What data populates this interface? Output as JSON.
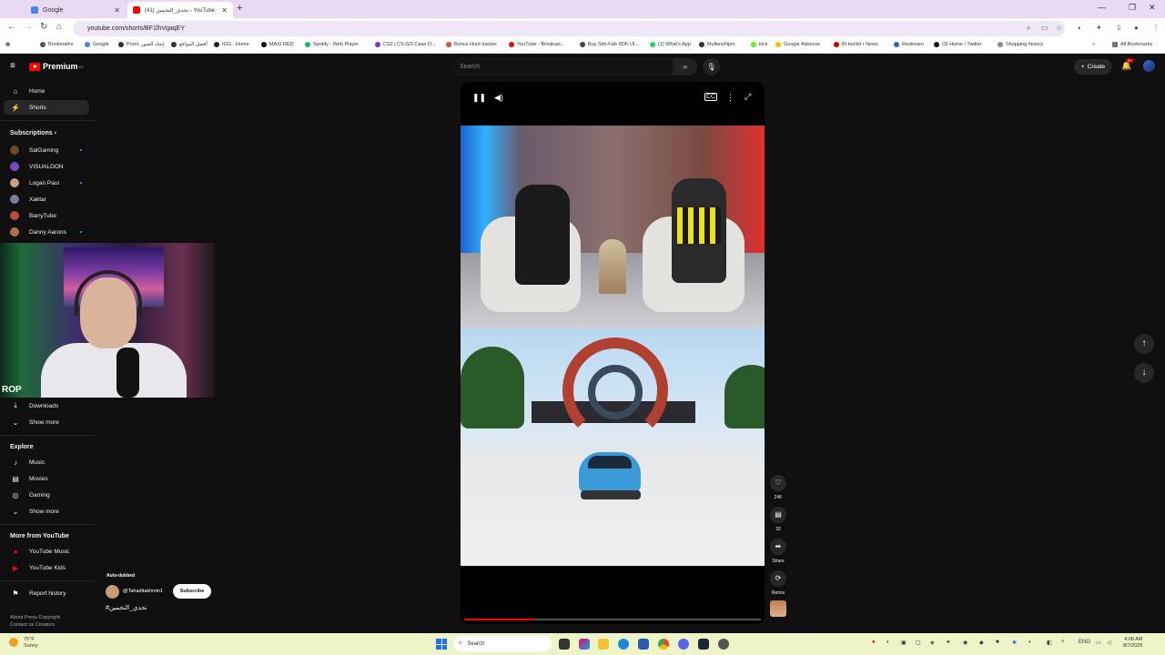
{
  "browser": {
    "tabs": [
      {
        "title": "Google"
      },
      {
        "title": "(41) تحدي_التخمين - YouTube"
      }
    ],
    "new_tab": "+",
    "url": "youtube.com/shorts/BF1lhVqaqEY",
    "bookmarks": [
      "Bookmarks",
      "Google",
      "ProoL إيجاد الصور",
      "أفضل المواقع",
      "IGG - Home",
      "MAXI RED",
      "Spotify - Web Player",
      "CS2 | CS:GO Case O...",
      "Bonus Hunt tracker",
      "YouTube - Breakaw...",
      "Buy Sim-Fab XDK Ul...",
      "(2) What's App",
      "MullenzNpm",
      "kick",
      "Google Adsense",
      "BI toolkit • News",
      "Restream",
      "(3) Home / Twitter",
      "Shopping history"
    ],
    "all_bookmarks": "All Bookmarks"
  },
  "youtube": {
    "logo_text": "Premium",
    "logo_sup": "MT",
    "search_placeholder": "Search",
    "create_label": "Create",
    "notif_count": "9+"
  },
  "sidebar": {
    "main": [
      {
        "label": "Home",
        "icon": "home-icon"
      },
      {
        "label": "Shorts",
        "icon": "shorts-icon",
        "active": true
      }
    ],
    "subscriptions_heading": "Subscriptions",
    "subscriptions": [
      {
        "name": "SalGaming",
        "color": "#6a4a2a",
        "new": true
      },
      {
        "name": "VISUALDON",
        "color": "#7a4ac0",
        "new": false
      },
      {
        "name": "Logan Paul",
        "color": "#c8a080",
        "new": true
      },
      {
        "name": "Xaktar",
        "color": "#708090",
        "new": false
      },
      {
        "name": "BarryTube",
        "color": "#c04a3a",
        "new": false
      },
      {
        "name": "Danny Aarons",
        "color": "#b07050",
        "new": true
      }
    ],
    "downloads": "Downloads",
    "show_more": "Show more",
    "explore_heading": "Explore",
    "explore": [
      {
        "label": "Music",
        "icon": "music-icon"
      },
      {
        "label": "Movies",
        "icon": "movies-icon"
      },
      {
        "label": "Gaming",
        "icon": "gaming-icon"
      }
    ],
    "show_more_2": "Show more",
    "more_heading": "More from YouTube",
    "more": [
      {
        "label": "YouTube Music"
      },
      {
        "label": "YouTube Kids"
      }
    ],
    "report_history": "Report history",
    "footer_line1": "About  Press  Copyright",
    "footer_line2": "Contact us  Creators"
  },
  "webcam": {
    "overlay_text": "ROP"
  },
  "short": {
    "auto_dubbed": "Auto-dubbed",
    "channel": "@Tahaditakhmin1",
    "subscribe": "Subscribe",
    "caption": "#تحدي_التخمين",
    "progress": 0.24,
    "likes": "24K",
    "comments": "33",
    "share": "Share",
    "remix": "Remix"
  },
  "taskbar": {
    "weather_temp": "75°F",
    "weather_desc": "Sunny",
    "search": "Search",
    "lang": "ENG",
    "time": "4:08 AM",
    "date": "8/7/2025"
  }
}
